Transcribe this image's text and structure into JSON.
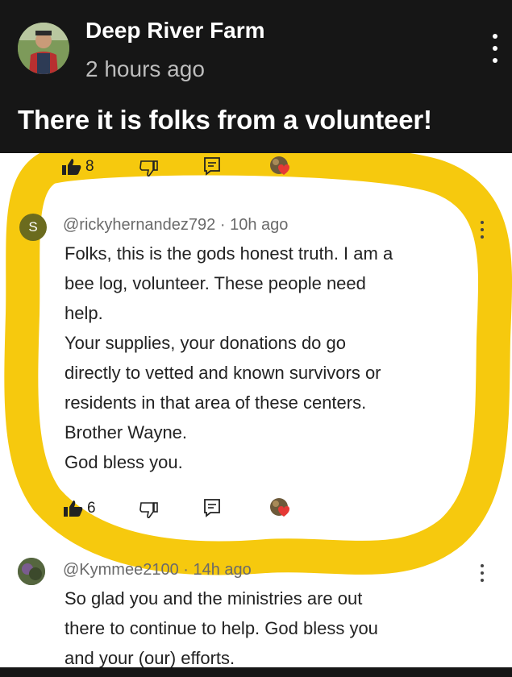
{
  "post": {
    "author": "Deep River Farm",
    "time": "2 hours ago",
    "text": "There it is folks from a volunteer!"
  },
  "screenshot": {
    "top_actions": {
      "likes": "8"
    },
    "comment1": {
      "avatar_letter": "S",
      "handle": "@rickyhernandez792",
      "time": "10h ago",
      "lines": [
        "Folks, this is the gods honest truth. I am a",
        "bee log, volunteer. These people need",
        "help.",
        "Your supplies, your donations do go",
        "directly to vetted and known survivors or",
        "residents in that area of these centers.",
        "Brother Wayne.",
        "God bless you."
      ],
      "likes": "6"
    },
    "comment2": {
      "handle": "@Kymmee2100",
      "time": "14h ago",
      "lines": [
        "So glad you and the ministries are out",
        "there to continue to help. God bless you",
        "and your (our) efforts."
      ]
    }
  },
  "colors": {
    "highlight": "#f6c90e",
    "avatar_s": "#6b6b1e",
    "heart": "#e53935"
  }
}
